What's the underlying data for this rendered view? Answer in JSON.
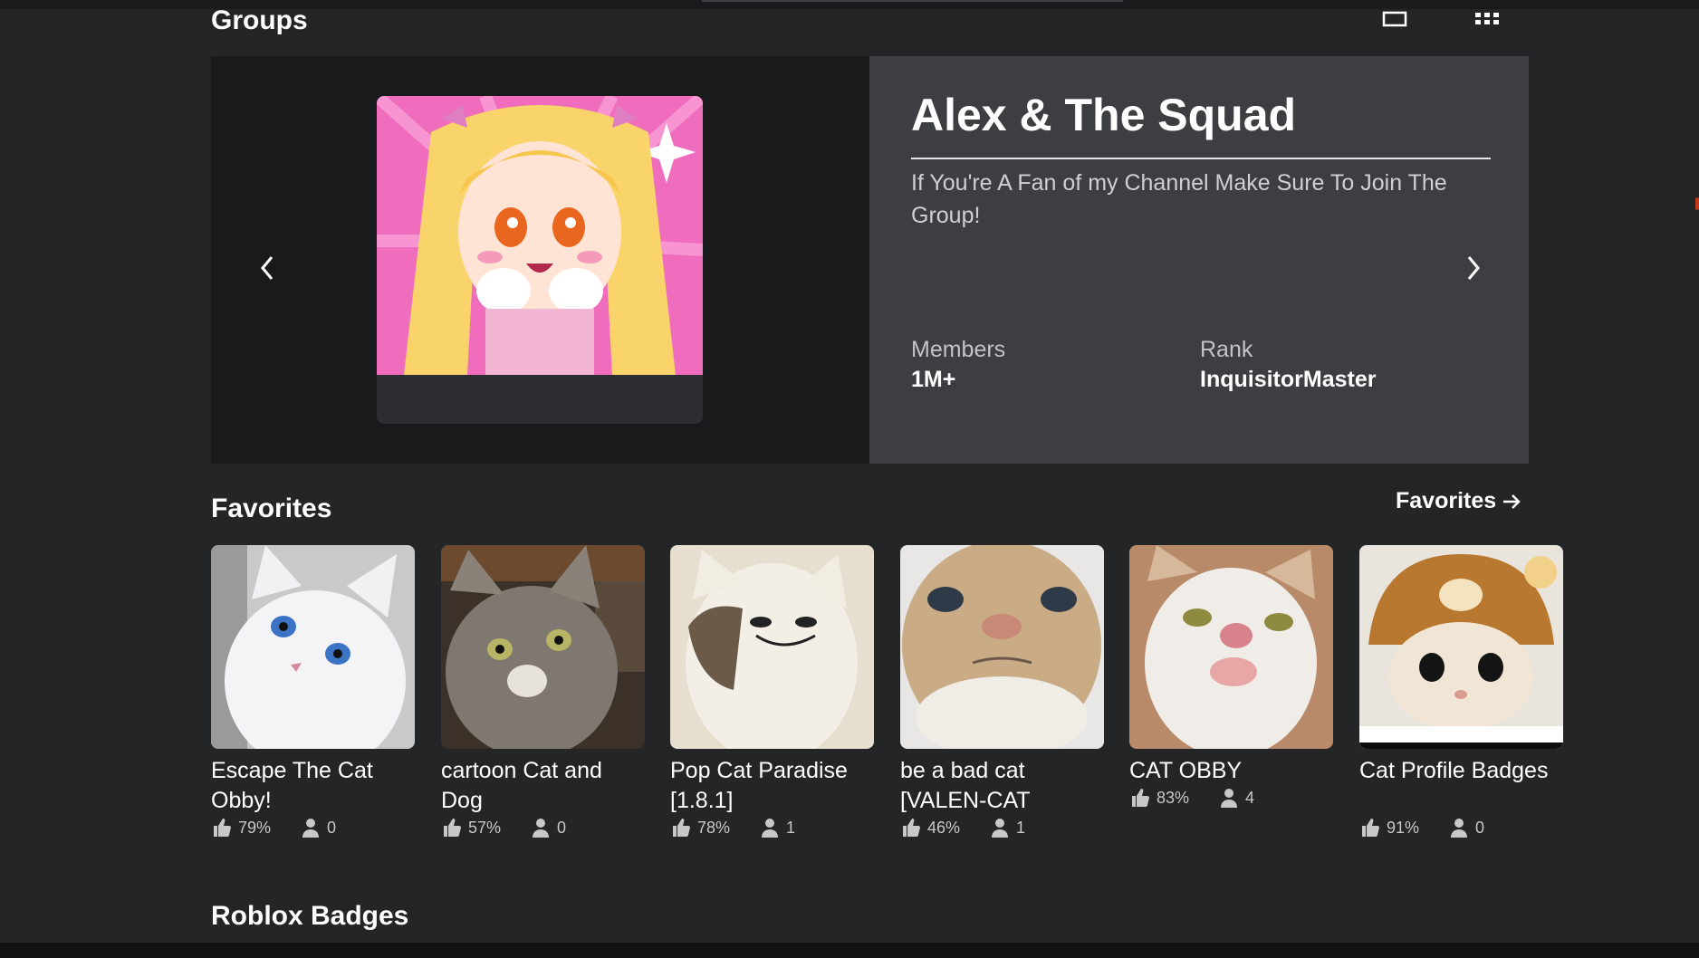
{
  "groups": {
    "section_title": "Groups",
    "view_toggle": {
      "single_icon": "single-view-icon",
      "grid_icon": "grid-view-icon"
    },
    "group": {
      "name": "Alex & The Squad",
      "description": "If You're A Fan of my Channel Make Sure To Join The Group!",
      "members_label": "Members",
      "members_value": "1M+",
      "rank_label": "Rank",
      "rank_value": "InquisitorMaster",
      "thumbnail": "anime-girl-group-emblem"
    },
    "prev_icon": "chevron-left-icon",
    "next_icon": "chevron-right-icon"
  },
  "favorites": {
    "section_title": "Favorites",
    "see_all_label": "Favorites",
    "see_all_icon": "arrow-right-icon",
    "games": [
      {
        "title": "Escape The Cat Obby!",
        "rating": "79%",
        "players": "0",
        "thumbnail": "white-cat"
      },
      {
        "title": "cartoon Cat and Dog",
        "rating": "57%",
        "players": "0",
        "thumbnail": "tabby-cat"
      },
      {
        "title": "Pop Cat Paradise [1.8.1]",
        "rating": "78%",
        "players": "1",
        "thumbnail": "pop-cat"
      },
      {
        "title": "be a bad cat [VALEN-CAT",
        "rating": "46%",
        "players": "1",
        "thumbnail": "orange-cat-closeup"
      },
      {
        "title": "CAT OBBY",
        "rating": "83%",
        "players": "4",
        "thumbnail": "surprised-cat"
      },
      {
        "title": "Cat Profile Badges",
        "rating": "91%",
        "players": "0",
        "thumbnail": "cat-in-bear-hat"
      }
    ]
  },
  "badges": {
    "section_title": "Roblox Badges"
  },
  "colors": {
    "background": "#232527",
    "panel_dark": "#191a1c",
    "panel_light": "#3c3e41",
    "text": "#ffffff",
    "muted": "#c7c8ca"
  }
}
